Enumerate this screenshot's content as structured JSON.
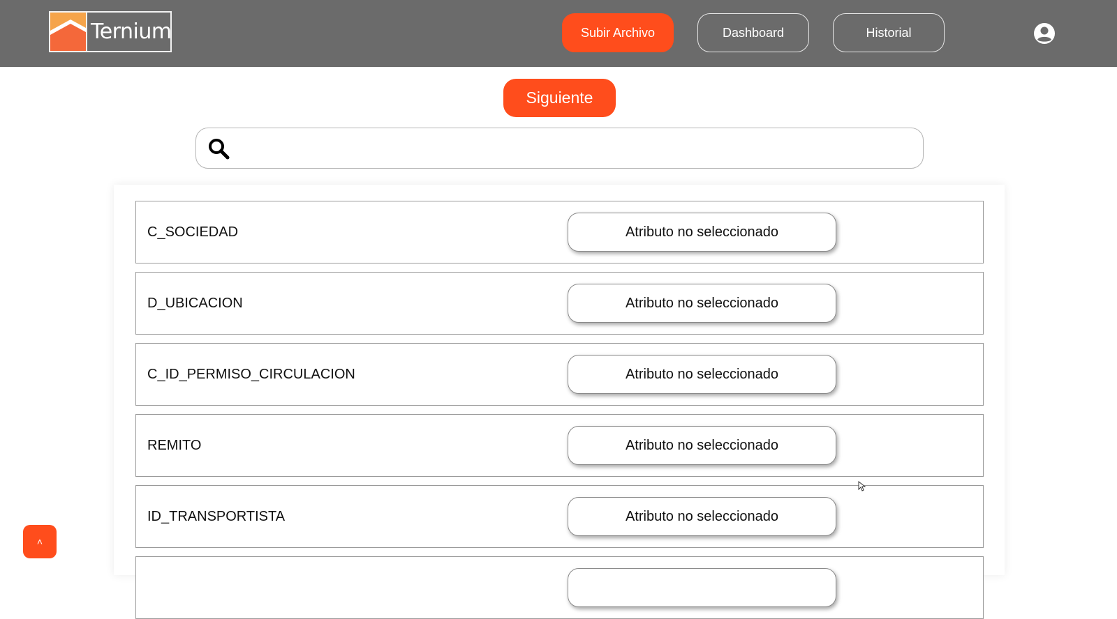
{
  "header": {
    "logo_text": "Ternium",
    "nav": [
      {
        "label": "Subir Archivo",
        "variant": "primary"
      },
      {
        "label": "Dashboard",
        "variant": "outline"
      },
      {
        "label": "Historial",
        "variant": "outline"
      }
    ],
    "user_icon": "user-circle-icon"
  },
  "toolbar": {
    "next_label": "Siguiente"
  },
  "search": {
    "placeholder": "",
    "value": "",
    "icon": "search-icon"
  },
  "rows": [
    {
      "name": "C_SOCIEDAD",
      "attribute": "Atributo no seleccionado"
    },
    {
      "name": "D_UBICACION",
      "attribute": "Atributo no seleccionado"
    },
    {
      "name": "C_ID_PERMISO_CIRCULACION",
      "attribute": "Atributo no seleccionado"
    },
    {
      "name": "REMITO",
      "attribute": "Atributo no seleccionado"
    },
    {
      "name": "ID_TRANSPORTISTA",
      "attribute": "Atributo no seleccionado"
    },
    {
      "name": "",
      "attribute": ""
    }
  ],
  "scroll_top": {
    "glyph": "˄",
    "icon": "chevron-up-icon"
  },
  "colors": {
    "accent": "#ff4d1c",
    "header_bg": "#6b6b6b",
    "logo_orange": "#f47a3a",
    "logo_orange_light": "#f5a44a"
  }
}
